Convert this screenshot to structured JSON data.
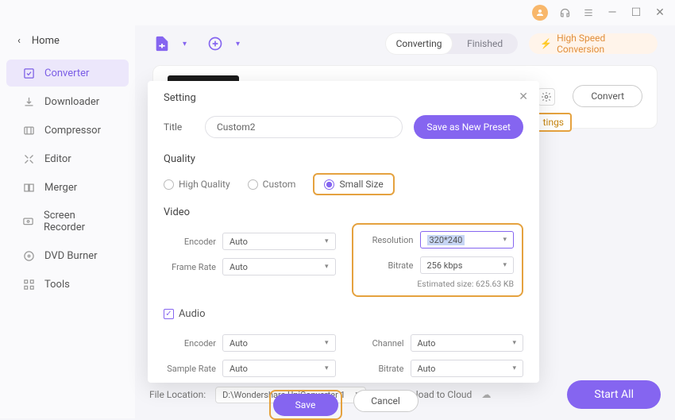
{
  "titlebar": {
    "min": "—",
    "max": "☐",
    "close": "✕"
  },
  "sidebar": {
    "back": "Home",
    "items": [
      {
        "label": "Converter"
      },
      {
        "label": "Downloader"
      },
      {
        "label": "Compressor"
      },
      {
        "label": "Editor"
      },
      {
        "label": "Merger"
      },
      {
        "label": "Screen Recorder"
      },
      {
        "label": "DVD Burner"
      },
      {
        "label": "Tools"
      }
    ]
  },
  "top": {
    "seg_converting": "Converting",
    "seg_finished": "Finished",
    "high_speed": "High Speed Conversion"
  },
  "card": {
    "settings_pill": "tings",
    "convert": "Convert"
  },
  "bottom": {
    "file_location_label": "File Location:",
    "file_location_value": "D:\\Wondershare UniConverter 1",
    "upload_cloud": "Upload to Cloud",
    "start_all": "Start All"
  },
  "modal": {
    "title": "Setting",
    "title_label": "Title",
    "title_value": "Custom2",
    "save_preset": "Save as New Preset",
    "quality_h": "Quality",
    "q_high": "High Quality",
    "q_custom": "Custom",
    "q_small": "Small Size",
    "video_h": "Video",
    "encoder_label": "Encoder",
    "framerate_label": "Frame Rate",
    "resolution_label": "Resolution",
    "bitrate_label": "Bitrate",
    "video_encoder": "Auto",
    "video_framerate": "Auto",
    "video_resolution": "320*240",
    "video_bitrate": "256 kbps",
    "estimated": "Estimated size: 625.63 KB",
    "audio_h": "Audio",
    "samplerate_label": "Sample Rate",
    "channel_label": "Channel",
    "audio_encoder": "Auto",
    "audio_samplerate": "Auto",
    "audio_channel": "Auto",
    "audio_bitrate": "Auto",
    "save": "Save",
    "cancel": "Cancel",
    "caret": "▾"
  }
}
